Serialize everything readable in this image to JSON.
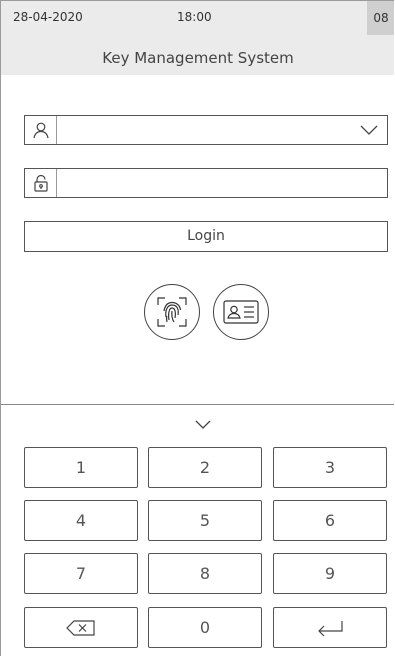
{
  "status_bar": {
    "date": "28-04-2020",
    "time": "18:00",
    "badge": "08"
  },
  "title": "Key Management System",
  "login_form": {
    "username_value": "",
    "password_value": "",
    "login_label": "Login",
    "icons": [
      "user-icon",
      "chevron-down-icon",
      "padlock-icon",
      "fingerprint-icon",
      "id-card-icon"
    ]
  },
  "keypad": {
    "collapse_icon": "chevron-down-icon",
    "rows": [
      [
        "1",
        "2",
        "3"
      ],
      [
        "4",
        "5",
        "6"
      ],
      [
        "7",
        "8",
        "9"
      ]
    ],
    "zero": "0",
    "backspace_icon": "backspace-icon",
    "enter_icon": "enter-icon"
  }
}
